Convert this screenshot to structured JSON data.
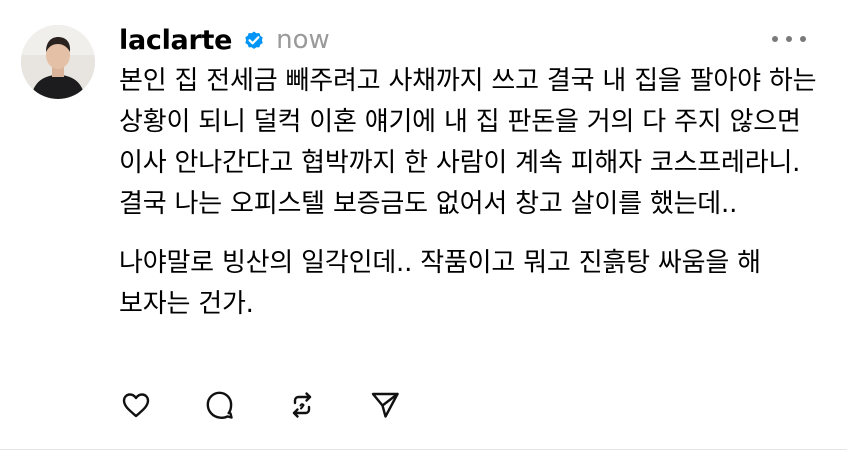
{
  "post": {
    "username": "laclarte",
    "time": "now",
    "paragraphs": [
      "본인 집 전세금 빼주려고 사채까지 쓰고 결국 내 집을 팔아야 하는 상황이 되니 덜컥 이혼 얘기에 내 집 판돈을 거의 다 주지 않으면 이사 안나간다고 협박까지 한 사람이 계속 피해자 코스프레라니. 결국 나는 오피스텔 보증금도 없어서 창고 살이를 했는데..",
      "나야말로 빙산의 일각인데.. 작품이고 뭐고 진흙탕 싸움을 해 보자는 건가."
    ]
  },
  "icons": {
    "verified": "verified-badge-icon",
    "more": "more-horizontal-icon",
    "like": "heart-icon",
    "reply": "comment-icon",
    "repost": "repost-icon",
    "share": "send-icon"
  },
  "colors": {
    "verified": "#0095f6",
    "timestamp": "#9a9a9a",
    "icon": "#111111"
  }
}
